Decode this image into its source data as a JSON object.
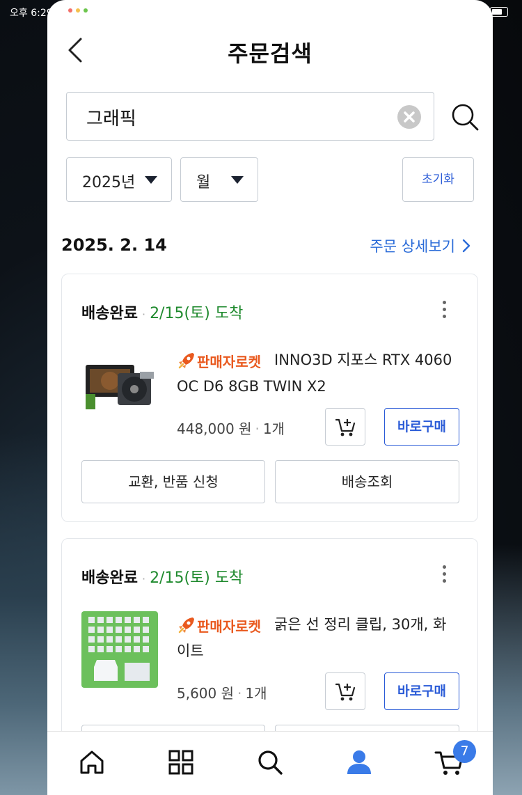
{
  "status_bar": {
    "time": "오후 6:29"
  },
  "header": {
    "title": "주문검색"
  },
  "search": {
    "value": "그래픽"
  },
  "filters": {
    "year": "2025년",
    "month": "월",
    "reset_label": "초기화"
  },
  "order": {
    "date": "2025. 2. 14",
    "detail_link": "주문 상세보기",
    "items": [
      {
        "status": "배송완료",
        "arrival": "2/15(토) 도착",
        "badge": "판매자로켓",
        "name": "INNO3D 지포스 RTX 4060 OC D6 8GB TWIN X2",
        "price": "448,000 원",
        "qty": "1개",
        "buy_label": "바로구매",
        "action_left": "교환, 반품 신청",
        "action_right": "배송조회"
      },
      {
        "status": "배송완료",
        "arrival": "2/15(토) 도착",
        "badge": "판매자로켓",
        "name": "굵은 선 정리 클립, 30개, 화이트",
        "price": "5,600 원",
        "qty": "1개",
        "buy_label": "바로구매"
      }
    ]
  },
  "bottom_nav": {
    "cart_badge": "7"
  },
  "colors": {
    "accent": "#2a5bd7",
    "arrival_green": "#1f8a2e",
    "rocket_orange": "#e9591e",
    "badge_blue": "#3a7be8"
  }
}
